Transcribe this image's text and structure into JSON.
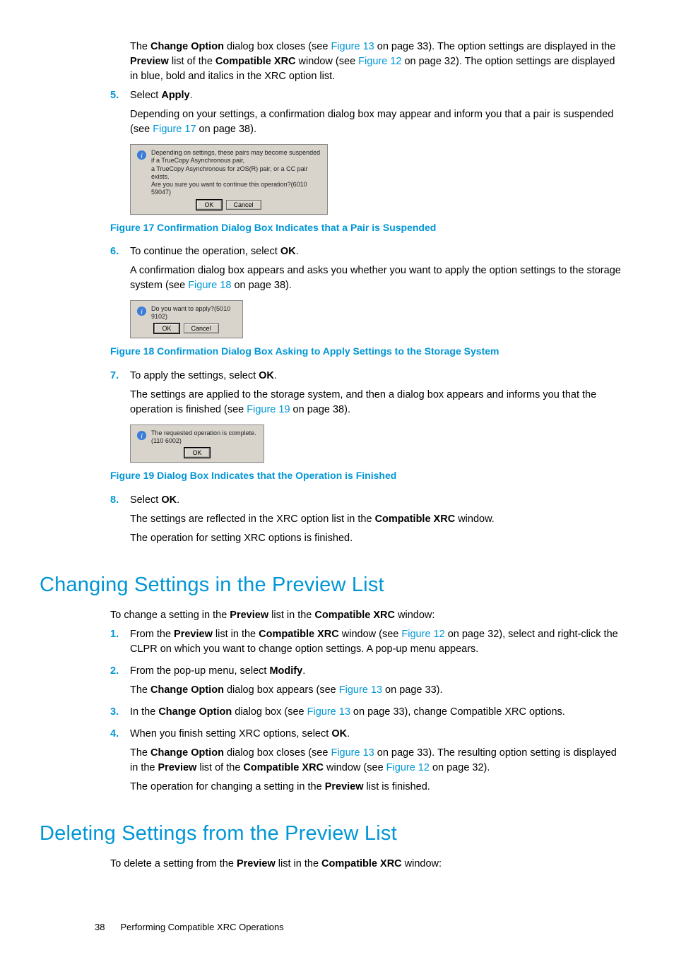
{
  "intro": {
    "p1a": "The ",
    "p1b": "Change Option",
    "p1c": " dialog box closes (see ",
    "p1d": "Figure 13",
    "p1e": " on page 33). The option settings are displayed in the ",
    "p1f": "Preview",
    "p1g": " list of the ",
    "p1h": "Compatible XRC",
    "p1i": " window (see ",
    "p1j": "Figure 12",
    "p1k": " on page 32). The option settings are displayed in blue, bold and italics in the XRC option list."
  },
  "step5": {
    "num": "5.",
    "a": "Select ",
    "b": "Apply",
    "c": ".",
    "d": "Depending on your settings, a confirmation dialog box may appear and inform you that a pair is suspended (see ",
    "e": "Figure 17",
    "f": " on page 38)."
  },
  "dialog17": {
    "line1": "Depending on settings, these pairs may become suspended if a TrueCopy Asynchronous pair,",
    "line2": "a TrueCopy Asynchronous for zOS(R) pair, or a CC pair exists.",
    "line3": "Are you sure you want to continue this operation?(6010 59047)",
    "ok": "OK",
    "cancel": "Cancel"
  },
  "caption17": "Figure 17 Confirmation Dialog Box Indicates that a Pair is Suspended",
  "step6": {
    "num": "6.",
    "a": "To continue the operation, select ",
    "b": "OK",
    "c": ".",
    "d": "A confirmation dialog box appears and asks you whether you want to apply the option settings to the storage system (see ",
    "e": "Figure 18",
    "f": " on page 38)."
  },
  "dialog18": {
    "msg": "Do you want to apply?(5010 9102)",
    "ok": "OK",
    "cancel": "Cancel"
  },
  "caption18": "Figure 18 Confirmation Dialog Box Asking to Apply Settings to the Storage System",
  "step7": {
    "num": "7.",
    "a": "To apply the settings, select ",
    "b": "OK",
    "c": ".",
    "d": "The settings are applied to the storage system, and then a dialog box appears and informs you that the operation is finished (see ",
    "e": "Figure 19",
    "f": " on page 38)."
  },
  "dialog19": {
    "msg": "The requested operation is complete.(110 6002)",
    "ok": "OK"
  },
  "caption19": "Figure 19 Dialog Box Indicates that the Operation is Finished",
  "step8": {
    "num": "8.",
    "a": "Select ",
    "b": "OK",
    "c": ".",
    "d1": "The settings are reflected in the XRC option list in the ",
    "d2": "Compatible XRC",
    "d3": " window.",
    "e": "The operation for setting XRC options is finished."
  },
  "sectionChange": {
    "title": "Changing Settings in the Preview List",
    "intro_a": "To change a setting in the ",
    "intro_b": "Preview",
    "intro_c": " list in the ",
    "intro_d": "Compatible XRC",
    "intro_e": " window:",
    "s1": {
      "num": "1.",
      "a": "From the ",
      "b": "Preview",
      "c": " list in the ",
      "d": "Compatible XRC",
      "e": " window (see ",
      "f": "Figure 12",
      "g": " on page 32), select and right-click the CLPR on which you want to change option settings. A pop-up menu appears."
    },
    "s2": {
      "num": "2.",
      "a": "From the pop-up menu, select ",
      "b": "Modify",
      "c": ".",
      "d": "The ",
      "e": "Change Option",
      "f": " dialog box appears (see ",
      "g": "Figure 13",
      "h": " on page 33)."
    },
    "s3": {
      "num": "3.",
      "a": "In the ",
      "b": "Change Option",
      "c": " dialog box (see ",
      "d": "Figure 13",
      "e": " on page 33), change Compatible XRC options."
    },
    "s4": {
      "num": "4.",
      "a": "When you finish setting XRC options, select ",
      "b": "OK",
      "c": ".",
      "d": "The ",
      "e": "Change Option",
      "f": " dialog box closes (see ",
      "g": "Figure 13",
      "h": " on page 33). The resulting option setting is displayed in the ",
      "i": "Preview",
      "j": " list of the ",
      "k": "Compatible XRC",
      "l": " window (see ",
      "m": "Figure 12",
      "n": " on page 32).",
      "o1": "The operation for changing a setting in the ",
      "o2": "Preview",
      "o3": " list is finished."
    }
  },
  "sectionDelete": {
    "title": "Deleting Settings from the Preview List",
    "intro_a": "To delete a setting from the ",
    "intro_b": "Preview",
    "intro_c": " list in the ",
    "intro_d": "Compatible XRC",
    "intro_e": " window:"
  },
  "footer": {
    "page": "38",
    "chapter": "Performing Compatible XRC Operations"
  }
}
